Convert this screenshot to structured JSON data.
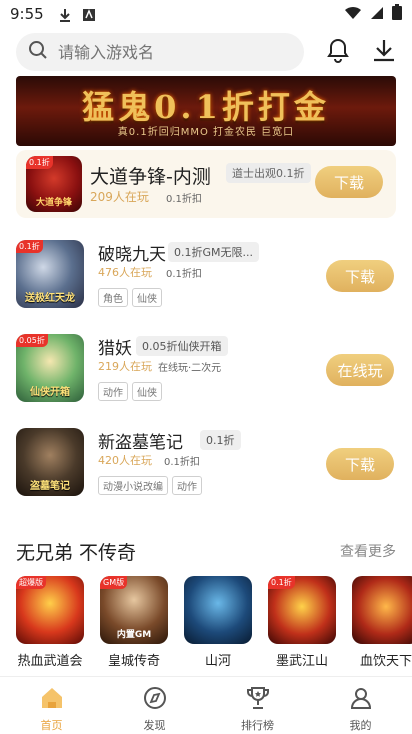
{
  "status_bar": {
    "time": "9:55"
  },
  "search": {
    "placeholder": "请输入游戏名"
  },
  "banner": {
    "title": "猛鬼0.1折打金",
    "subtitle": "真0.1折回归MMO 打金农民 巨宽口"
  },
  "featured": {
    "name": "大道争锋-内测",
    "badge": "道士出观0.1折",
    "players": "209人在玩",
    "meta": "0.1折扣",
    "icon_tag": "0.1折",
    "icon_text": "大道争锋",
    "button": "下载"
  },
  "games": [
    {
      "name": "破晓九天",
      "badge": "0.1折GM无限...",
      "players": "476人在玩",
      "meta": "0.1折扣",
      "tags": [
        "角色",
        "仙侠"
      ],
      "button": "下载",
      "icon_tag": "0.1折",
      "icon_text": "送极红天龙"
    },
    {
      "name": "猎妖",
      "badge": "0.05折仙侠开箱",
      "players": "219人在玩",
      "meta": "在线玩·二次元",
      "tags": [
        "动作",
        "仙侠"
      ],
      "button": "在线玩",
      "icon_tag": "0.05折",
      "icon_text": "仙侠开箱"
    },
    {
      "name": "新盗墓笔记",
      "badge": "0.1折",
      "players": "420人在玩",
      "meta": "0.1折扣",
      "tags": [
        "动漫小说改编",
        "动作"
      ],
      "button": "下载",
      "icon_tag": "",
      "icon_text": "盗墓笔记"
    }
  ],
  "section": {
    "title": "无兄弟  不传奇",
    "more": "查看更多",
    "items": [
      {
        "name": "热血武道会",
        "icon_tag": "超爆版",
        "icon_text": ""
      },
      {
        "name": "皇城传奇",
        "icon_tag": "GM版",
        "icon_text": "内置GM"
      },
      {
        "name": "山河",
        "icon_tag": "",
        "icon_text": ""
      },
      {
        "name": "墨武江山",
        "icon_tag": "0.1折",
        "icon_text": ""
      },
      {
        "name": "血饮天下",
        "icon_tag": "",
        "icon_text": ""
      }
    ]
  },
  "nav": [
    {
      "label": "首页",
      "active": true
    },
    {
      "label": "发现",
      "active": false
    },
    {
      "label": "排行榜",
      "active": false
    },
    {
      "label": "我的",
      "active": false
    }
  ],
  "colors": {
    "accent": "#e8a33c",
    "button": "#e0b15e",
    "players": "#d9a75a"
  }
}
